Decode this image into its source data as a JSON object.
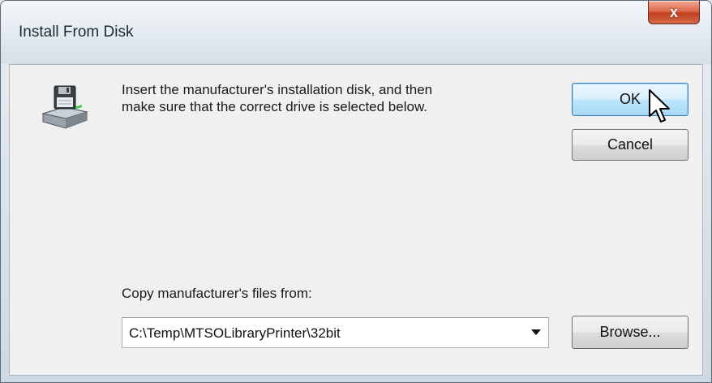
{
  "window": {
    "title": "Install From Disk",
    "close_label": "x"
  },
  "icons": {
    "disk": "floppy-disk-drive-icon",
    "close": "close-icon",
    "dropdown": "chevron-down-icon",
    "cursor": "mouse-cursor-icon"
  },
  "message": {
    "line1": "Insert the manufacturer's installation disk, and then",
    "line2": "make sure that the correct drive is selected below."
  },
  "buttons": {
    "ok": "OK",
    "cancel": "Cancel",
    "browse": "Browse..."
  },
  "copy_from": {
    "label": "Copy manufacturer's files from:",
    "value": "C:\\Temp\\MTSOLibraryPrinter\\32bit"
  },
  "colors": {
    "close_button": "#c2401f",
    "default_button": "#bee6fd",
    "client_bg": "#f0f0f0"
  }
}
